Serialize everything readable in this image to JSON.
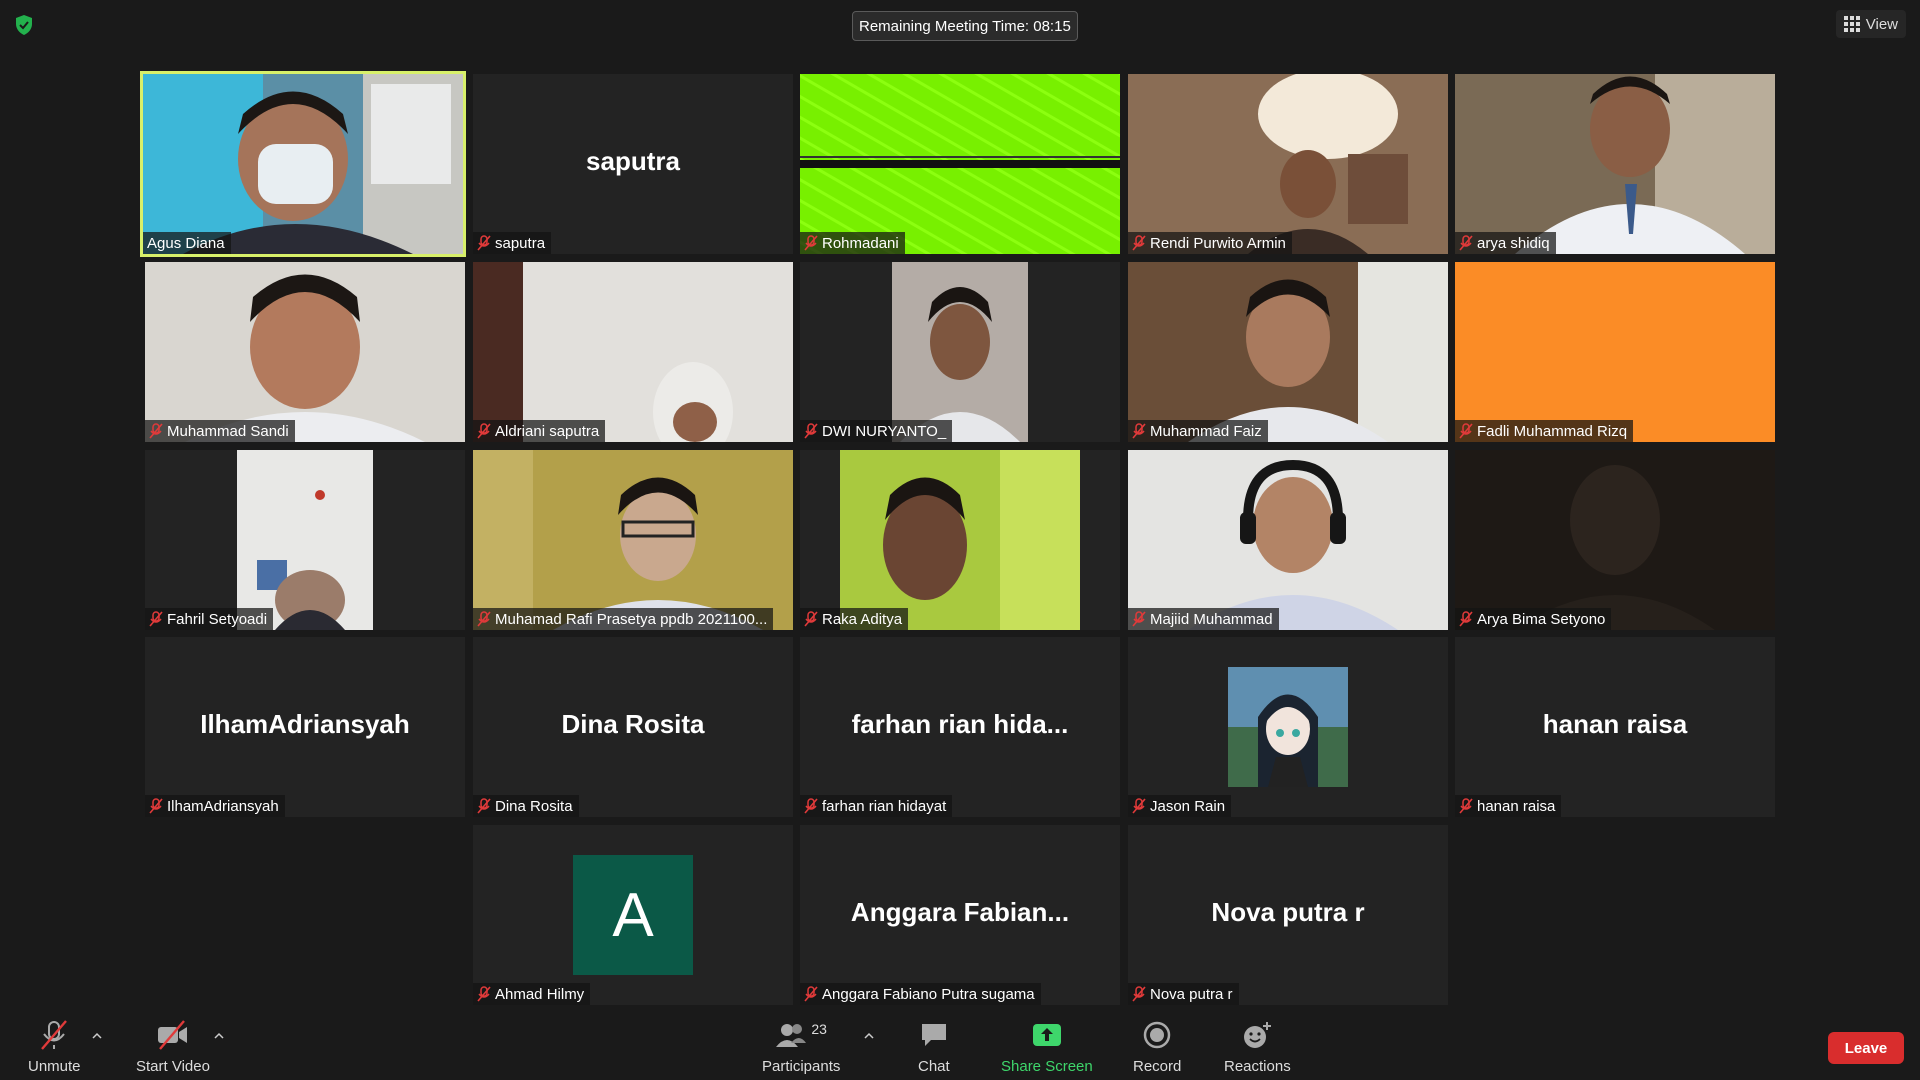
{
  "meeting": {
    "timer_label": "Remaining Meeting Time: 08:15",
    "view_label": "View"
  },
  "participants": [
    {
      "name": "Agus Diana",
      "muted": false,
      "type": "video"
    },
    {
      "name": "saputra",
      "big": "saputra",
      "muted": true,
      "type": "name"
    },
    {
      "name": "Rohmadani",
      "muted": true,
      "type": "video"
    },
    {
      "name": "Rendi Purwito Armin",
      "muted": true,
      "type": "video"
    },
    {
      "name": "arya shidiq",
      "muted": true,
      "type": "video"
    },
    {
      "name": "Muhammad Sandi",
      "muted": true,
      "type": "video"
    },
    {
      "name": "Aldriani saputra",
      "muted": true,
      "type": "video"
    },
    {
      "name": "DWI NURYANTO_",
      "muted": true,
      "type": "video"
    },
    {
      "name": "Muhammad Faiz",
      "muted": true,
      "type": "video"
    },
    {
      "name": "Fadli Muhammad Rizq",
      "muted": true,
      "type": "video"
    },
    {
      "name": "Fahril Setyoadi",
      "muted": true,
      "type": "video"
    },
    {
      "name": "Muhamad Rafi Prasetya ppdb 2021100...",
      "muted": true,
      "type": "video"
    },
    {
      "name": "Raka Aditya",
      "muted": true,
      "type": "video"
    },
    {
      "name": "Majiid Muhammad",
      "muted": true,
      "type": "video"
    },
    {
      "name": "Arya Bima Setyono",
      "muted": true,
      "type": "video"
    },
    {
      "name": "IlhamAdriansyah",
      "big": "IlhamAdriansyah",
      "muted": true,
      "type": "name"
    },
    {
      "name": "Dina Rosita",
      "big": "Dina Rosita",
      "muted": true,
      "type": "name"
    },
    {
      "name": "farhan rian hidayat",
      "big": "farhan  rian  hida...",
      "muted": true,
      "type": "name"
    },
    {
      "name": "Jason Rain",
      "muted": true,
      "type": "picture"
    },
    {
      "name": "hanan raisa",
      "big": "hanan raisa",
      "muted": true,
      "type": "name"
    },
    {
      "name": "Ahmad Hilmy",
      "initial": "A",
      "muted": true,
      "type": "initial"
    },
    {
      "name": "Anggara Fabiano Putra sugama",
      "big": "Anggara  Fabian...",
      "muted": true,
      "type": "name"
    },
    {
      "name": "Nova putra r",
      "big": "Nova putra r",
      "muted": true,
      "type": "name"
    }
  ],
  "toolbar": {
    "unmute": "Unmute",
    "start_video": "Start Video",
    "participants": "Participants",
    "participants_count": "23",
    "chat": "Chat",
    "share_screen": "Share Screen",
    "record": "Record",
    "reactions": "Reactions",
    "leave": "Leave"
  },
  "colors": {
    "background": "#1a1a1a",
    "active_speaker": "#d8f06a",
    "share_green": "#3ed66b",
    "leave_red": "#d92d2d",
    "muted_red": "#e03a3a"
  }
}
